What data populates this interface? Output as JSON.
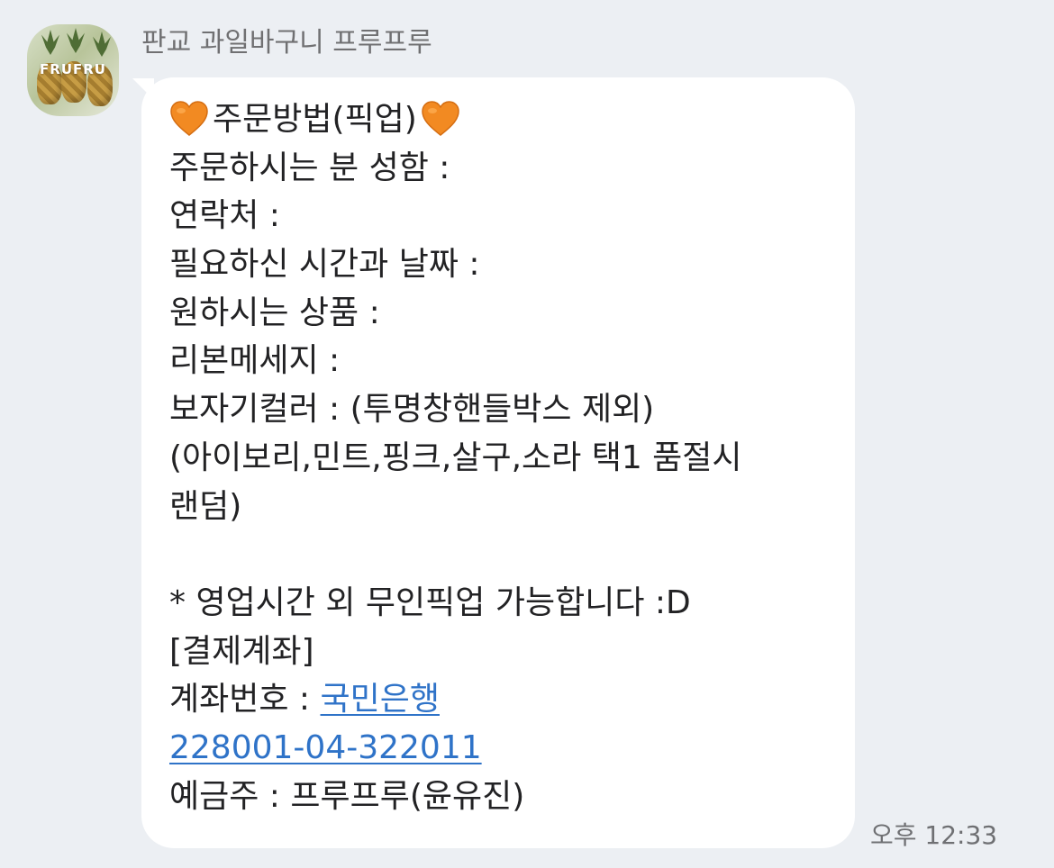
{
  "chat": {
    "sender_name": "판교 과일바구니 프루프루",
    "avatar_logo_text": "FRUFRU",
    "timestamp": "오후 12:33",
    "accent_color": "#2f73c8",
    "message": {
      "title": "주문방법(픽업)",
      "heart_icon": "orange-heart-icon",
      "lines": [
        "주문하시는 분 성함 :",
        "연락처 :",
        "필요하신 시간과 날짜 :",
        "원하시는 상품 :",
        "리본메세지 :",
        "보자기컬러 :  (투명창핸들박스 제외)",
        "(아이보리,민트,핑크,살구,소라 택1 품절시",
        "랜덤)"
      ],
      "notice": "* 영업시간 외 무인픽업 가능합니다 :D",
      "account_header": "[결제계좌]",
      "account_label": "계좌번호 : ",
      "bank_link": "국민은행",
      "account_number_link": "228001-04-322011",
      "holder": "예금주 : 프루프루(윤유진)"
    }
  }
}
